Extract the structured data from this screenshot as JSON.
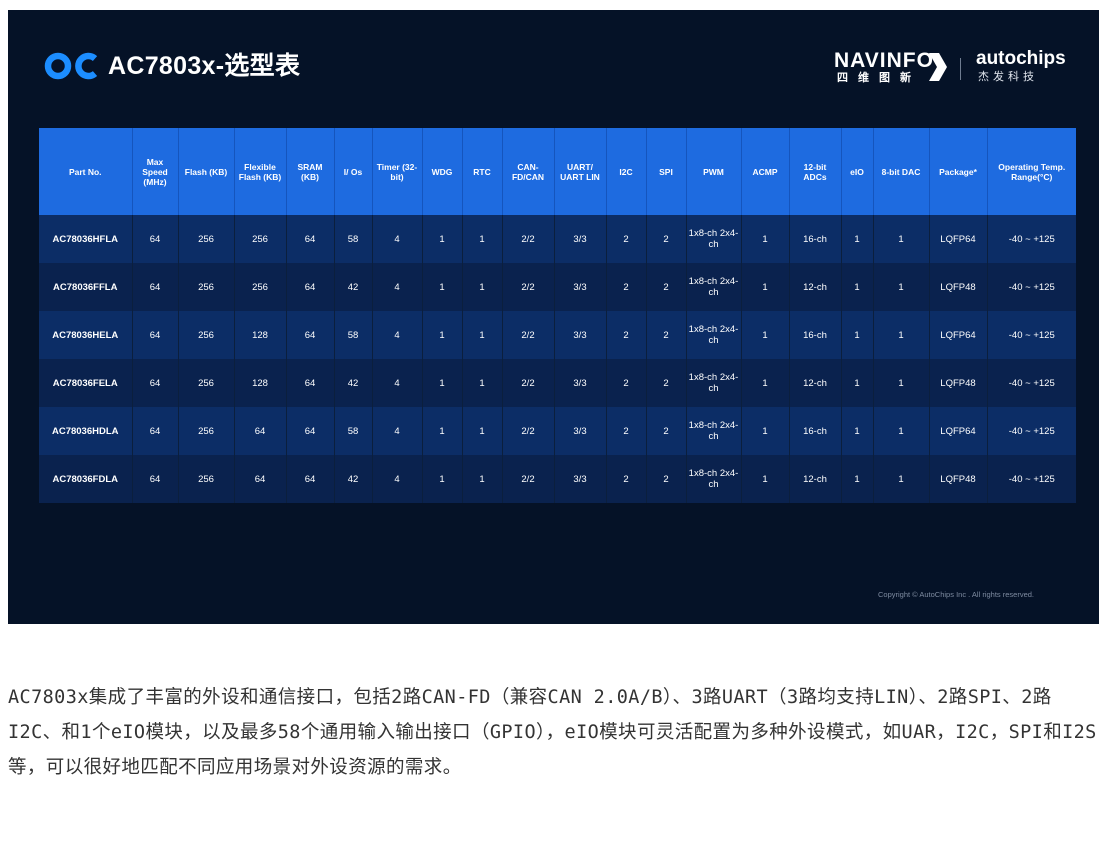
{
  "header": {
    "logo_text": "OC",
    "title": "AC7803x-选型表"
  },
  "brands": {
    "navinfo_name": "NAVINFO",
    "navinfo_cn": "四维图新",
    "autochips_name": "autochips",
    "autochips_cn": "杰发科技"
  },
  "table": {
    "headers": [
      "Part No.",
      "Max Speed (MHz)",
      "Flash (KB)",
      "Flexible Flash (KB)",
      "SRAM (KB)",
      "I/ Os",
      "Timer (32-bit)",
      "WDG",
      "RTC",
      "CAN-FD/CAN",
      "UART/ UART LIN",
      "I2C",
      "SPI",
      "PWM",
      "ACMP",
      "12-bit ADCs",
      "eIO",
      "8-bit DAC",
      "Package*",
      "Operating Temp. Range(°C)"
    ],
    "rows": [
      [
        "AC78036HFLA",
        "64",
        "256",
        "256",
        "64",
        "58",
        "4",
        "1",
        "1",
        "2/2",
        "3/3",
        "2",
        "2",
        "1x8-ch 2x4-ch",
        "1",
        "16-ch",
        "1",
        "1",
        "LQFP64",
        "-40 ~ +125"
      ],
      [
        "AC78036FFLA",
        "64",
        "256",
        "256",
        "64",
        "42",
        "4",
        "1",
        "1",
        "2/2",
        "3/3",
        "2",
        "2",
        "1x8-ch 2x4-ch",
        "1",
        "12-ch",
        "1",
        "1",
        "LQFP48",
        "-40 ~ +125"
      ],
      [
        "AC78036HELA",
        "64",
        "256",
        "128",
        "64",
        "58",
        "4",
        "1",
        "1",
        "2/2",
        "3/3",
        "2",
        "2",
        "1x8-ch 2x4-ch",
        "1",
        "16-ch",
        "1",
        "1",
        "LQFP64",
        "-40 ~ +125"
      ],
      [
        "AC78036FELA",
        "64",
        "256",
        "128",
        "64",
        "42",
        "4",
        "1",
        "1",
        "2/2",
        "3/3",
        "2",
        "2",
        "1x8-ch 2x4-ch",
        "1",
        "12-ch",
        "1",
        "1",
        "LQFP48",
        "-40 ~ +125"
      ],
      [
        "AC78036HDLA",
        "64",
        "256",
        "64",
        "64",
        "58",
        "4",
        "1",
        "1",
        "2/2",
        "3/3",
        "2",
        "2",
        "1x8-ch 2x4-ch",
        "1",
        "16-ch",
        "1",
        "1",
        "LQFP64",
        "-40 ~ +125"
      ],
      [
        "AC78036FDLA",
        "64",
        "256",
        "64",
        "64",
        "42",
        "4",
        "1",
        "1",
        "2/2",
        "3/3",
        "2",
        "2",
        "1x8-ch 2x4-ch",
        "1",
        "12-ch",
        "1",
        "1",
        "LQFP48",
        "-40 ~ +125"
      ]
    ]
  },
  "copyright": "Copyright © AutoChips Inc . All rights reserved.",
  "description": "AC7803x集成了丰富的外设和通信接口，包括2路CAN-FD（兼容CAN 2.0A/B）、3路UART（3路均支持LIN）、2路SPI、2路I2C、和1个eIO模块，以及最多58个通用输入输出接口（GPIO），eIO模块可灵活配置为多种外设模式，如UAR，I2C，SPI和I2S等，可以很好地匹配不同应用场景对外设资源的需求。",
  "colors": {
    "slide_bg": "#051227",
    "header_blue": "#1e6be0",
    "row_odd": "#0c2d66",
    "row_even": "#0a224e",
    "logo_blue": "#1c8dff"
  }
}
